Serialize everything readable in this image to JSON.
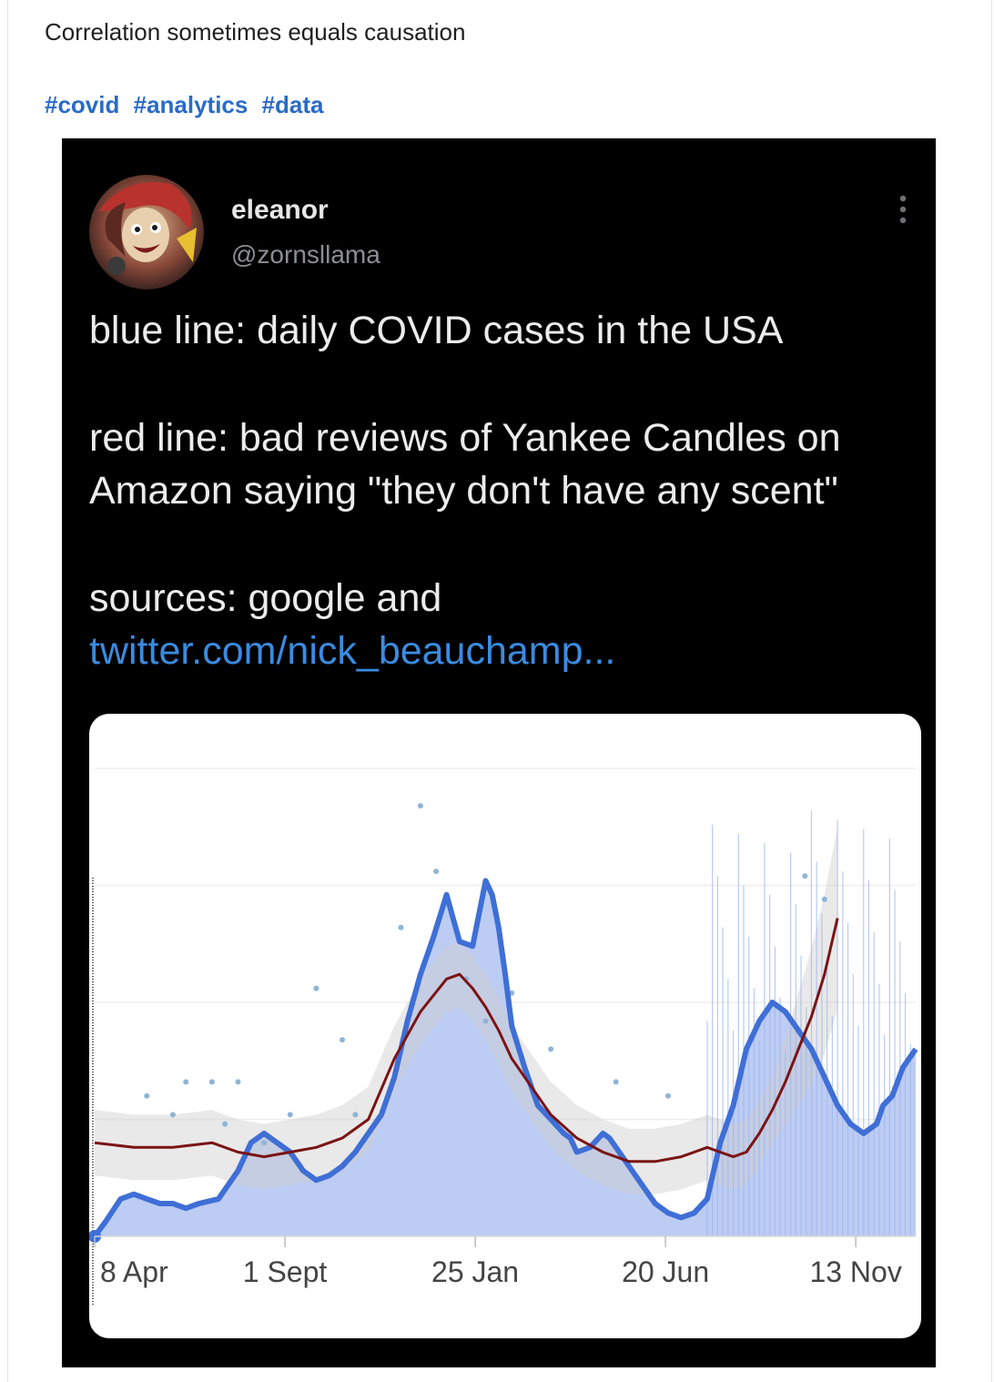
{
  "post": {
    "text": "Correlation sometimes equals causation",
    "hashtags": [
      "#covid",
      "#analytics",
      "#data"
    ]
  },
  "tweet": {
    "display_name": "eleanor",
    "handle": "@zornsllama",
    "line1": "blue line: daily COVID cases in the USA",
    "line2": "red line: bad reviews of Yankee Candles on Amazon saying \"they don't have any scent\"",
    "line3_prefix": "sources: google and ",
    "line3_link": "twitter.com/nick_beauchamp...",
    "link_color": "#3a8be0"
  },
  "chart_data": {
    "type": "line",
    "x_tick_labels": [
      "8 Apr",
      "1 Sept",
      "25 Jan",
      "20 Jun",
      "13 Nov"
    ],
    "x_ticks": [
      0,
      146,
      292,
      438,
      584
    ],
    "x_range": [
      0,
      630
    ],
    "y_range": [
      0,
      100
    ],
    "grid": true,
    "legend": "none",
    "series": [
      {
        "color": "#3f6fd6",
        "fill": "#b9c9f2",
        "points": [
          [
            0,
            0
          ],
          [
            8,
            3
          ],
          [
            20,
            8
          ],
          [
            30,
            9
          ],
          [
            40,
            8
          ],
          [
            50,
            7
          ],
          [
            60,
            7
          ],
          [
            70,
            6
          ],
          [
            80,
            7
          ],
          [
            95,
            8
          ],
          [
            110,
            14
          ],
          [
            120,
            20
          ],
          [
            130,
            22
          ],
          [
            140,
            20
          ],
          [
            150,
            18
          ],
          [
            160,
            14
          ],
          [
            170,
            12
          ],
          [
            180,
            13
          ],
          [
            190,
            15
          ],
          [
            200,
            18
          ],
          [
            210,
            22
          ],
          [
            220,
            26
          ],
          [
            230,
            34
          ],
          [
            240,
            46
          ],
          [
            250,
            56
          ],
          [
            260,
            64
          ],
          [
            270,
            73
          ],
          [
            275,
            68
          ],
          [
            280,
            63
          ],
          [
            290,
            62
          ],
          [
            300,
            76
          ],
          [
            305,
            73
          ],
          [
            310,
            66
          ],
          [
            315,
            56
          ],
          [
            320,
            45
          ],
          [
            330,
            36
          ],
          [
            340,
            28
          ],
          [
            350,
            25
          ],
          [
            360,
            22
          ],
          [
            365,
            21
          ],
          [
            370,
            18
          ],
          [
            380,
            19
          ],
          [
            390,
            22
          ],
          [
            395,
            21
          ],
          [
            400,
            19
          ],
          [
            410,
            15
          ],
          [
            420,
            11
          ],
          [
            430,
            7
          ],
          [
            440,
            5
          ],
          [
            450,
            4
          ],
          [
            460,
            5
          ],
          [
            470,
            8
          ],
          [
            475,
            14
          ],
          [
            480,
            20
          ],
          [
            490,
            28
          ],
          [
            500,
            40
          ],
          [
            510,
            46
          ],
          [
            520,
            50
          ],
          [
            530,
            48
          ],
          [
            540,
            44
          ],
          [
            550,
            40
          ],
          [
            560,
            34
          ],
          [
            570,
            28
          ],
          [
            580,
            24
          ],
          [
            590,
            22
          ],
          [
            600,
            24
          ],
          [
            605,
            28
          ],
          [
            612,
            30
          ],
          [
            620,
            36
          ],
          [
            625,
            38
          ],
          [
            630,
            40
          ]
        ]
      },
      {
        "color": "#7a1414",
        "points": [
          [
            0,
            20
          ],
          [
            30,
            19
          ],
          [
            60,
            19
          ],
          [
            90,
            20
          ],
          [
            110,
            18
          ],
          [
            130,
            17
          ],
          [
            150,
            18
          ],
          [
            170,
            19
          ],
          [
            190,
            21
          ],
          [
            210,
            25
          ],
          [
            230,
            38
          ],
          [
            250,
            48
          ],
          [
            270,
            55
          ],
          [
            280,
            56
          ],
          [
            290,
            53
          ],
          [
            300,
            49
          ],
          [
            310,
            44
          ],
          [
            320,
            38
          ],
          [
            335,
            32
          ],
          [
            350,
            26
          ],
          [
            370,
            21
          ],
          [
            390,
            18
          ],
          [
            410,
            16
          ],
          [
            430,
            16
          ],
          [
            450,
            17
          ],
          [
            460,
            18
          ],
          [
            470,
            19
          ],
          [
            480,
            18
          ],
          [
            490,
            17
          ],
          [
            500,
            18
          ],
          [
            510,
            22
          ],
          [
            520,
            27
          ],
          [
            530,
            33
          ],
          [
            540,
            40
          ],
          [
            550,
            47
          ],
          [
            560,
            56
          ],
          [
            565,
            62
          ],
          [
            570,
            68
          ]
        ]
      }
    ]
  }
}
